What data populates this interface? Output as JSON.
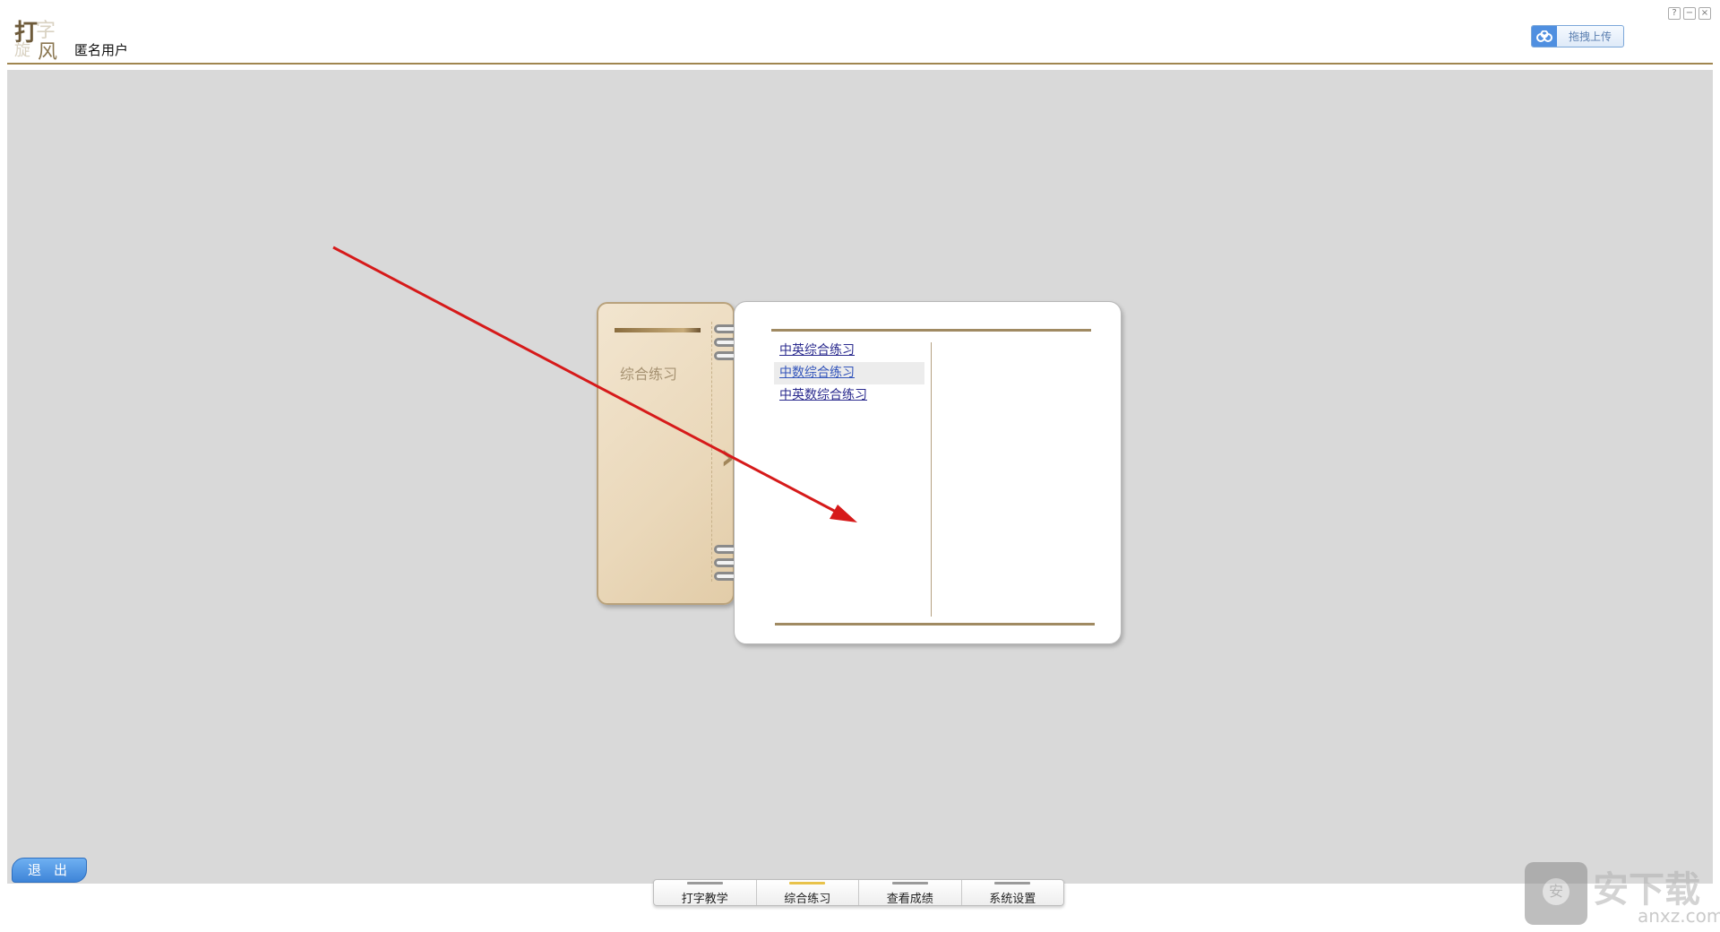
{
  "header": {
    "logo_chars": [
      "打",
      "字",
      "旋",
      "风"
    ],
    "username": "匿名用户",
    "upload_label": "拖拽上传",
    "window_controls": [
      "?",
      "−",
      "×"
    ]
  },
  "notebook": {
    "cover_label": "综合练习",
    "items": [
      {
        "label": "中英综合练习"
      },
      {
        "label": "中数综合练习"
      },
      {
        "label": "中英数综合练习"
      }
    ]
  },
  "footer": {
    "exit_label": "退出",
    "tabs": [
      {
        "label": "打字教学",
        "active": false
      },
      {
        "label": "综合练习",
        "active": true
      },
      {
        "label": "查看成绩",
        "active": false
      },
      {
        "label": "系统设置",
        "active": false
      }
    ]
  },
  "watermark": {
    "main": "安下载",
    "sub": "anxz.com",
    "badge": "安"
  },
  "colors": {
    "accent_line": "#a08650",
    "annotation_arrow": "#d61a1a",
    "active_tab_indicator": "#e8c24a"
  }
}
